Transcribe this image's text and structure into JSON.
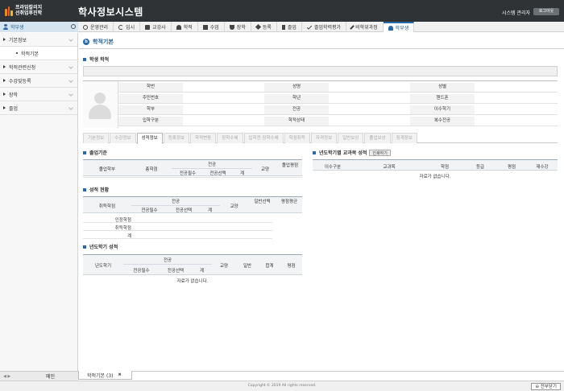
{
  "header": {
    "logo_line1": "프라임칼리지",
    "logo_line2": "선취업후진학",
    "title": "학사정보시스템",
    "user": "시스템 관리자",
    "logout": "로그아웃"
  },
  "menu": {
    "side_label": "학부생",
    "items": [
      {
        "label": "운영관리"
      },
      {
        "label": "입시"
      },
      {
        "label": "교강사"
      },
      {
        "label": "학적"
      },
      {
        "label": "수업"
      },
      {
        "label": "장학"
      },
      {
        "label": "등록"
      },
      {
        "label": "졸업"
      },
      {
        "label": "졸업학력평가"
      },
      {
        "label": "비학위과정"
      },
      {
        "label": "학부생"
      }
    ]
  },
  "sidebar": {
    "items": [
      {
        "label": "기본정보"
      },
      {
        "label": "학적기본"
      },
      {
        "label": "학적관련신청"
      },
      {
        "label": "수강및등록"
      },
      {
        "label": "장학"
      },
      {
        "label": "졸업"
      }
    ]
  },
  "page": {
    "title": "학적기본",
    "section_student": "학생 학적",
    "info_rows": [
      [
        "학번",
        "성명",
        "성별"
      ],
      [
        "주민번호",
        "학년",
        "핸드폰"
      ],
      [
        "학부",
        "전공",
        "이수학기"
      ],
      [
        "입학구분",
        "학적상태",
        "복수전공"
      ]
    ],
    "tabs": [
      "기본정보",
      "수강정보",
      "성적정보",
      "등록정보",
      "학적변동",
      "장학수혜",
      "입학전 장학수혜",
      "학점취득",
      "자격정보",
      "일반보상",
      "졸업보상",
      "징계정보"
    ],
    "graduation": {
      "title": "졸업기준",
      "h_group": "전공",
      "headers": [
        "졸업학부",
        "총학점",
        "전공필수",
        "전공선택",
        "계",
        "교양",
        "졸업평점"
      ]
    },
    "grade_status": {
      "title": "성적 현황",
      "h_group": "전공",
      "headers": [
        "취득학점",
        "전공필수",
        "전공선택",
        "계",
        "교양",
        "일반선택",
        "평점평균"
      ],
      "rows": [
        "인정학점",
        "취득학점",
        "계"
      ]
    },
    "year_grade": {
      "title": "년도학기 성적",
      "h_group": "전공",
      "headers": [
        "년도학기",
        "전공필수",
        "전공선택",
        "계",
        "교양",
        "일반",
        "합계",
        "평점"
      ],
      "empty": "자료가 없습니다."
    },
    "course_grade": {
      "title": "년도학기별 교과목 성적",
      "print": "인쇄하기",
      "headers": [
        "이수구분",
        "교과목",
        "학점",
        "등급",
        "평점",
        "재수강"
      ],
      "empty": "자료가 없습니다."
    }
  },
  "bottom": {
    "home": "메인",
    "open_tab": "학적기본 (3)",
    "copyright": "Copyright © 2019 All rights reserved.",
    "expand": "전부닫기"
  }
}
